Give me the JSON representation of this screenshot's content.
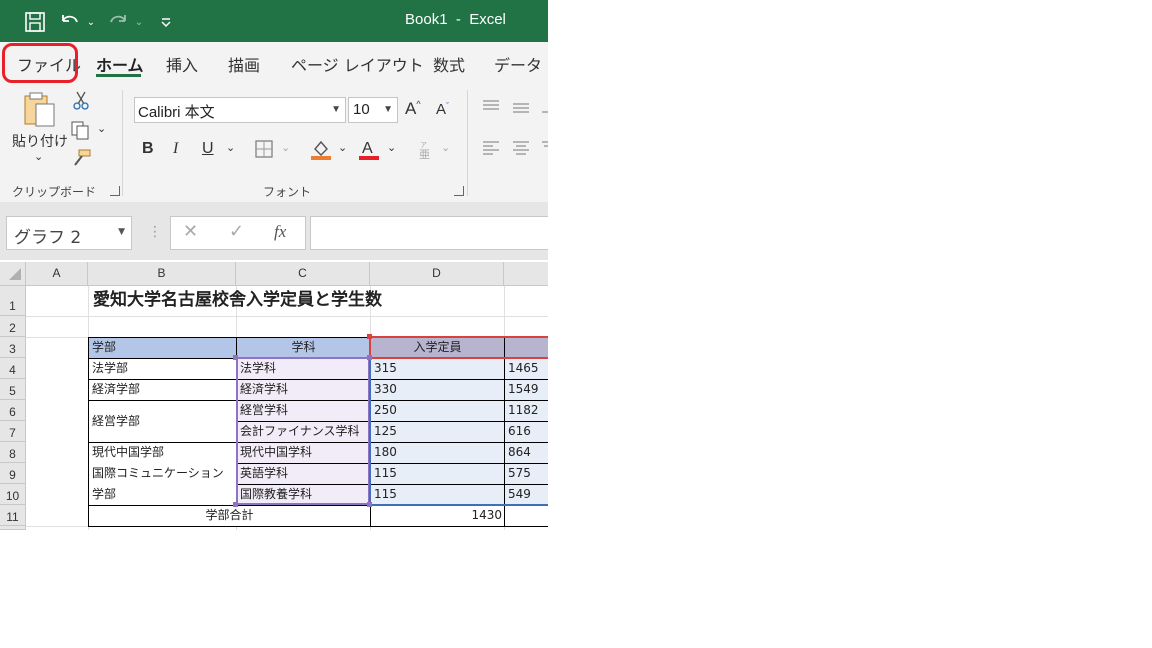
{
  "titlebar": {
    "title": "Book1  -  Excel",
    "icons": [
      "save-icon",
      "undo-icon",
      "redo-icon",
      "customize-qat-icon"
    ]
  },
  "tabs": [
    {
      "label": "ファイル",
      "highlighted": true
    },
    {
      "label": "ホーム",
      "active": true
    },
    {
      "label": "挿入"
    },
    {
      "label": "描画"
    },
    {
      "label": "ページ レイアウト"
    },
    {
      "label": "数式"
    },
    {
      "label": "データ"
    }
  ],
  "ribbon": {
    "clipboard": {
      "paste_label": "貼り付け",
      "group_label": "クリップボード"
    },
    "font": {
      "font_name": "Calibri 本文",
      "font_size": "10",
      "group_label": "フォント",
      "bold": "B",
      "italic": "I",
      "underline": "U",
      "grow": "A",
      "shrink": "A"
    }
  },
  "formula_bar": {
    "name_box": "グラフ 2",
    "fx": "fx",
    "formula": ""
  },
  "colors": {
    "accent": "#217346",
    "highlight_red": "#e8202a",
    "header_fill": "#b4c6e7",
    "selection_fill": "#e8eef8",
    "purple_fill": "#f1ecf7"
  },
  "sheet": {
    "columns": [
      "A",
      "B",
      "C",
      "D"
    ],
    "rows": [
      "1",
      "2",
      "3",
      "4",
      "5",
      "6",
      "7",
      "8",
      "9",
      "10",
      "11"
    ],
    "title": "愛知大学名古屋校舎入学定員と学生数",
    "headers": {
      "b": "学部",
      "c": "学科",
      "d": "入学定員"
    },
    "data": [
      {
        "b": "法学部",
        "c": "法学科",
        "d": "315",
        "e": "1465"
      },
      {
        "b": "経済学部",
        "c": "経済学科",
        "d": "330",
        "e": "1549"
      },
      {
        "b": "経営学部",
        "c": "経営学科",
        "d": "250",
        "e": "1182"
      },
      {
        "b": "",
        "c": "会計ファイナンス学科",
        "d": "125",
        "e": "616"
      },
      {
        "b": "現代中国学部",
        "c": "現代中国学科",
        "d": "180",
        "e": "864"
      },
      {
        "b": "国際コミュニケーション",
        "c": "英語学科",
        "d": "115",
        "e": "575"
      },
      {
        "b": "学部",
        "c": "国際教養学科",
        "d": "115",
        "e": "549"
      }
    ],
    "total_label": "学部合計",
    "total_value": "1430"
  }
}
